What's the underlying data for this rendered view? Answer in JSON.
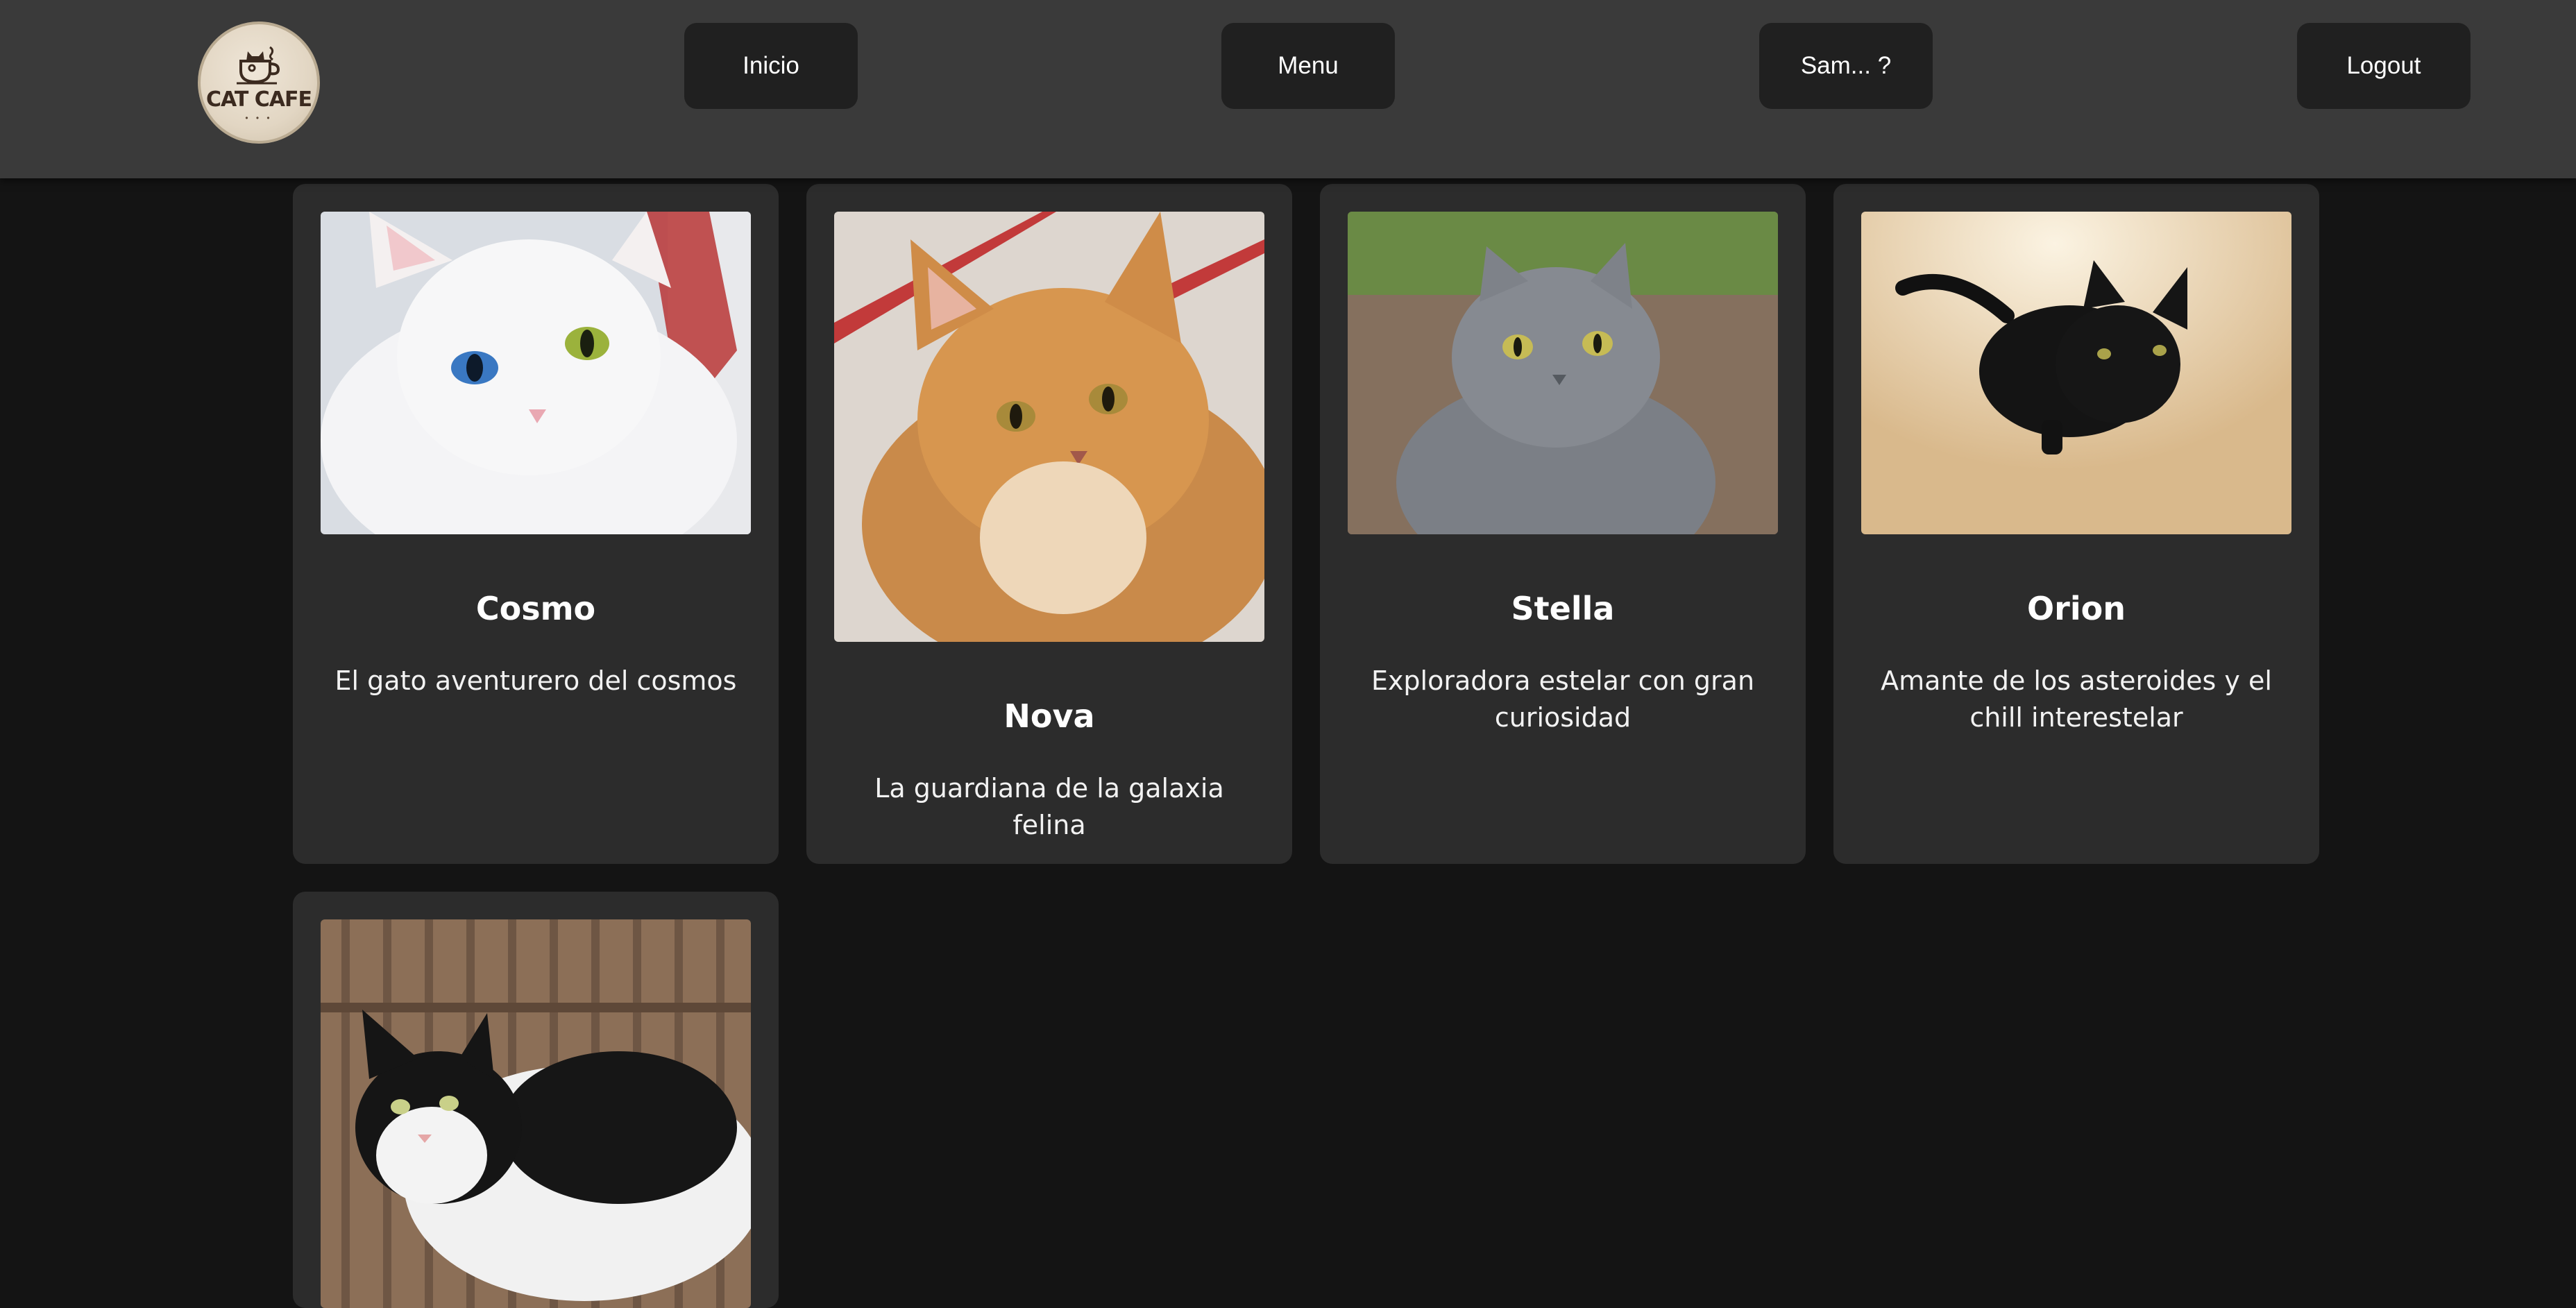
{
  "nav": {
    "logo_text": "CAT CAFE",
    "buttons": [
      {
        "label": "Inicio"
      },
      {
        "label": "Menu"
      },
      {
        "label": "Sam... ?"
      },
      {
        "label": "Logout"
      }
    ]
  },
  "cats": [
    {
      "name": "Cosmo",
      "description": "El gato aventurero del cosmos",
      "image": "white-cat-heterochromia"
    },
    {
      "name": "Nova",
      "description": "La guardiana de la galaxia felina",
      "image": "orange-tabby-cat"
    },
    {
      "name": "Stella",
      "description": "Exploradora estelar con gran curiosidad",
      "image": "gray-cat"
    },
    {
      "name": "Orion",
      "description": "Amante de los asteroides y el chill interestelar",
      "image": "black-cat"
    },
    {
      "name": "",
      "description": "",
      "image": "black-white-cat"
    }
  ],
  "colors": {
    "background": "#141414",
    "navbar": "#3a3a3a",
    "button": "#202020",
    "card": "#2c2c2c"
  }
}
